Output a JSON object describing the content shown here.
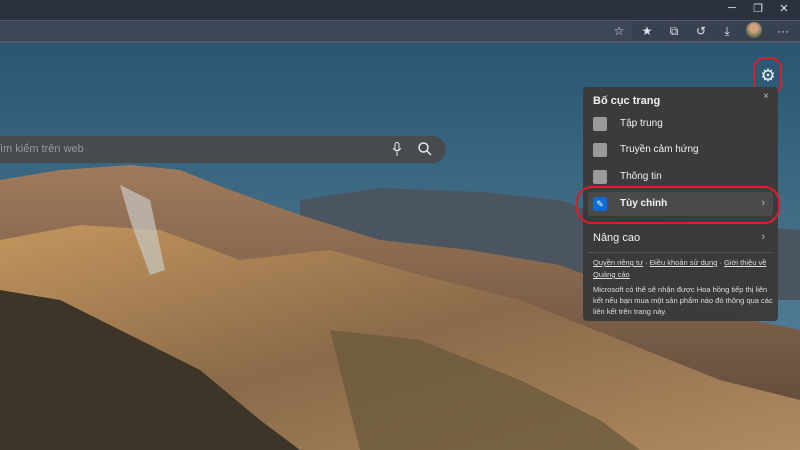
{
  "window": {
    "minimize": "─",
    "restore": "❐",
    "close": "✕"
  },
  "toolbar": {
    "favorite_add": "☆",
    "favorites": "★",
    "collections": "⧉",
    "history": "↺",
    "downloads": "⤓",
    "more": "···"
  },
  "search": {
    "placeholder": "ìm kiếm trên web"
  },
  "icons": {
    "mic": "mic-icon",
    "search": "search-icon",
    "gear": "gear-icon"
  },
  "panel": {
    "title": "Bố cục trang",
    "close": "×",
    "items": [
      {
        "label": "Tập trung"
      },
      {
        "label": "Truyền cảm hứng"
      },
      {
        "label": "Thông tin"
      },
      {
        "label": "Tùy chỉnh",
        "selected": true
      }
    ],
    "advanced": "Nâng cao",
    "links": [
      "Quyền riêng tư",
      "Điều khoản sử dụng",
      "Giới thiệu về Quảng cáo"
    ],
    "disclaimer": "Microsoft có thể sẽ nhận được Hoa hồng tiếp thị liên kết nếu bạn mua một sản phẩm nào đó thông qua các liên kết trên trang này."
  },
  "colors": {
    "highlight_ring": "#e01b2b",
    "accent": "#0f6cd6"
  }
}
